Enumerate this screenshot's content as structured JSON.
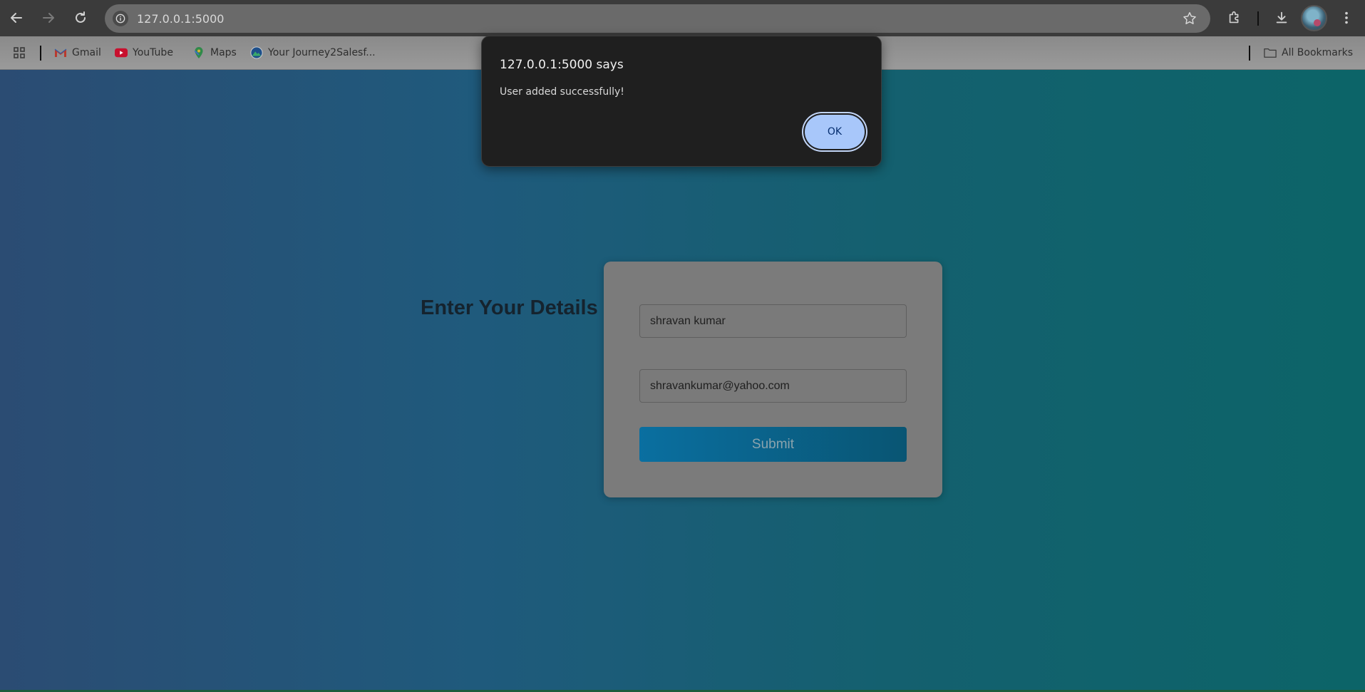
{
  "browser": {
    "url": "127.0.0.1:5000",
    "bookmarks": [
      {
        "label": "Gmail",
        "icon": "gmail-icon"
      },
      {
        "label": "YouTube",
        "icon": "youtube-icon"
      },
      {
        "label": "Maps",
        "icon": "maps-icon"
      },
      {
        "label": "Your Journey2Salesf...",
        "icon": "trailhead-icon"
      }
    ],
    "all_bookmarks_label": "All Bookmarks"
  },
  "page": {
    "heading": "Enter Your Details",
    "form": {
      "name_value": "shravan kumar",
      "email_value": "shravankumar@yahoo.com",
      "submit_label": "Submit"
    }
  },
  "dialog": {
    "title": "127.0.0.1:5000 says",
    "message": "User added successfully!",
    "ok_label": "OK"
  },
  "colors": {
    "dialog_bg": "#1f1f1f",
    "ok_button": "#a8c7fa",
    "submit_button": "#0a6fa0"
  }
}
